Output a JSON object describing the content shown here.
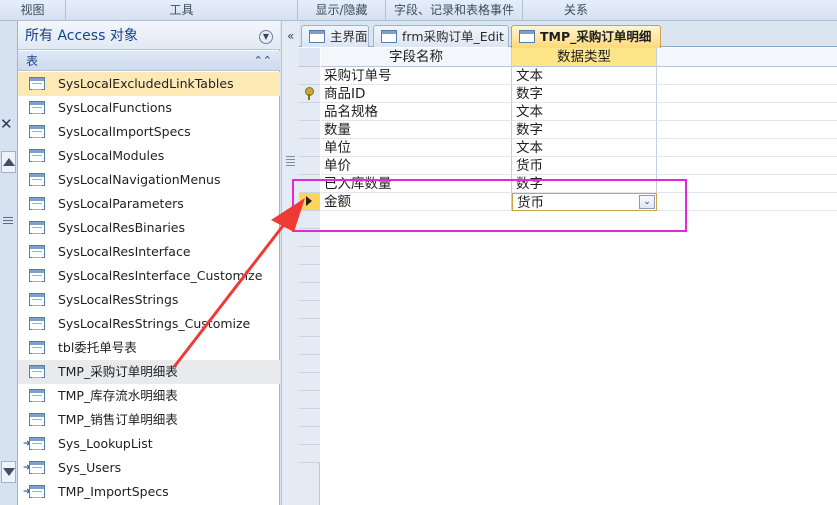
{
  "ribbon": {
    "groups": [
      "视图",
      "工具",
      "显示/隐藏",
      "字段、记录和表格事件",
      "关系"
    ]
  },
  "nav": {
    "title": "所有 Access 对象",
    "section": "表",
    "items": [
      {
        "label": "SysLocalExcludedLinkTables",
        "state": "hover"
      },
      {
        "label": "SysLocalFunctions"
      },
      {
        "label": "SysLocalImportSpecs"
      },
      {
        "label": "SysLocalModules"
      },
      {
        "label": "SysLocalNavigationMenus"
      },
      {
        "label": "SysLocalParameters"
      },
      {
        "label": "SysLocalResBinaries"
      },
      {
        "label": "SysLocalResInterface"
      },
      {
        "label": "SysLocalResInterface_Customize"
      },
      {
        "label": "SysLocalResStrings"
      },
      {
        "label": "SysLocalResStrings_Customize"
      },
      {
        "label": "tbl委托单号表"
      },
      {
        "label": "TMP_采购订单明细表",
        "state": "selected"
      },
      {
        "label": "TMP_库存流水明细表"
      },
      {
        "label": "TMP_销售订单明细表"
      },
      {
        "label": "Sys_LookupList",
        "linked": true
      },
      {
        "label": "Sys_Users",
        "linked": true
      },
      {
        "label": "TMP_ImportSpecs",
        "linked": true
      }
    ]
  },
  "tabs": [
    {
      "label": "主界面"
    },
    {
      "label": "frm采购订单_Edit"
    },
    {
      "label": "TMP_采购订单明细表",
      "active": true
    }
  ],
  "grid": {
    "headers": {
      "field_name": "字段名称",
      "data_type": "数据类型"
    },
    "rows": [
      {
        "field": "采购订单号",
        "type": "文本"
      },
      {
        "field": "商品ID",
        "type": "数字",
        "primary_key": true
      },
      {
        "field": "品名规格",
        "type": "文本"
      },
      {
        "field": "数量",
        "type": "数字"
      },
      {
        "field": "单位",
        "type": "文本"
      },
      {
        "field": "单价",
        "type": "货币"
      },
      {
        "field": "已入库数量",
        "type": "数字"
      },
      {
        "field": "金额",
        "type": "货币",
        "editing": true
      }
    ]
  },
  "colors": {
    "highlight_box": "#e02ad6",
    "annotation_arrow": "#ee3a35",
    "active_tab": "#ffd978"
  }
}
